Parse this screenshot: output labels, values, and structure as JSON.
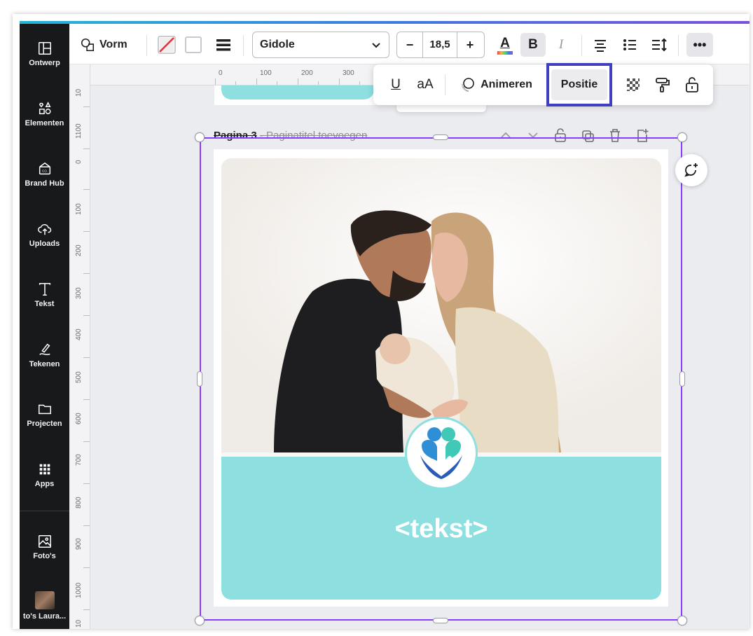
{
  "sidebar": {
    "items": [
      {
        "label": "Ontwerp",
        "icon": "layout-icon"
      },
      {
        "label": "Elementen",
        "icon": "shapes-icon"
      },
      {
        "label": "Brand Hub",
        "icon": "brand-hub-icon"
      },
      {
        "label": "Uploads",
        "icon": "cloud-upload-icon"
      },
      {
        "label": "Tekst",
        "icon": "text-icon"
      },
      {
        "label": "Tekenen",
        "icon": "draw-icon"
      },
      {
        "label": "Projecten",
        "icon": "folder-icon"
      },
      {
        "label": "Apps",
        "icon": "apps-grid-icon"
      },
      {
        "label": "Foto's",
        "icon": "photos-icon"
      },
      {
        "label": "to's Laura...",
        "icon": "photo-thumbnail"
      }
    ]
  },
  "toolbar": {
    "shape_label": "Vorm",
    "font_name": "Gidole",
    "font_size": "18,5",
    "minus": "−",
    "plus": "+",
    "bold": "B",
    "italic": "I",
    "more": "•••",
    "text_color_letter": "A"
  },
  "popover": {
    "underline": "U",
    "case": "aA",
    "animate": "Animeren",
    "position": "Positie"
  },
  "hruler": {
    "labels": [
      "0",
      "100",
      "200",
      "300"
    ]
  },
  "vruler": {
    "labels": [
      "10",
      "1100",
      "0",
      "100",
      "200",
      "300",
      "400",
      "500",
      "600",
      "700",
      "800",
      "900",
      "1000",
      "10"
    ]
  },
  "page": {
    "title": "Pagina 3",
    "subtitle": "Paginatitel toevoegen",
    "placeholder_text": "<tekst>"
  },
  "colors": {
    "sidebar_bg": "#18191b",
    "teal": "#8ee0e0",
    "selection": "#8b3dff",
    "highlight_box": "#3f3fc0"
  }
}
